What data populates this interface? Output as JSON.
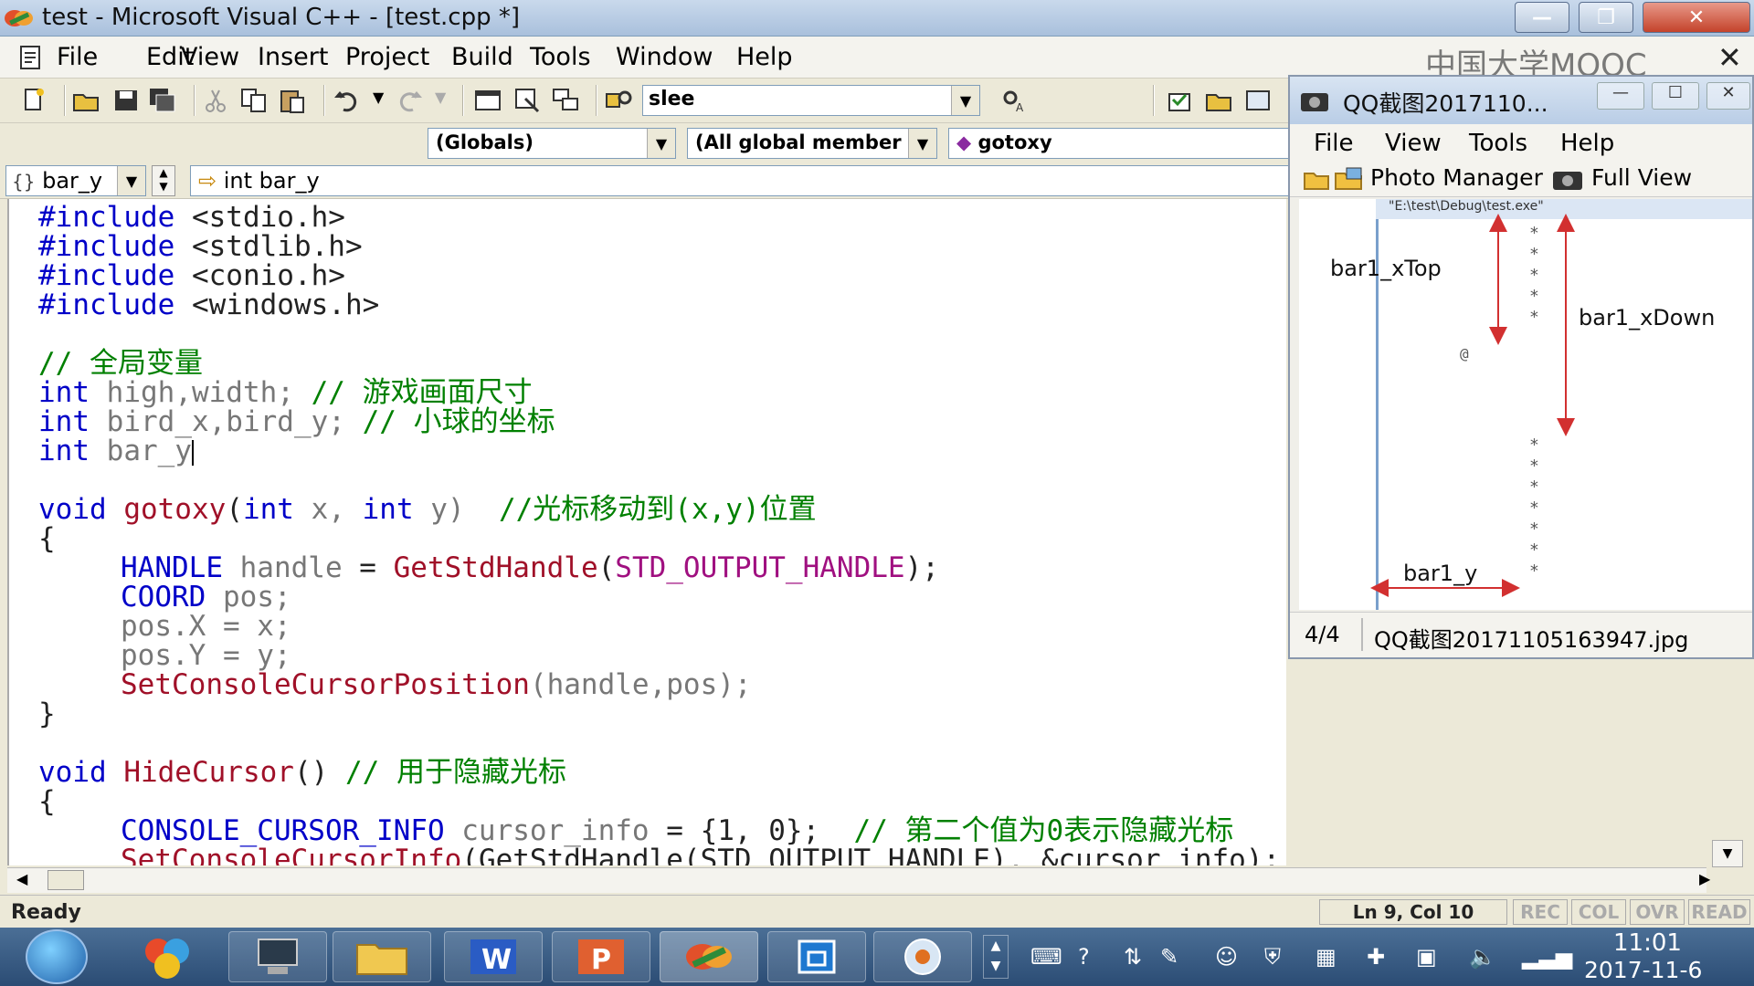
{
  "window": {
    "title": "test - Microsoft Visual C++ - [test.cpp *]",
    "min_glyph": "—",
    "max_glyph": "❐",
    "close_glyph": "✕"
  },
  "menu": [
    "File",
    "Edit",
    "View",
    "Insert",
    "Project",
    "Build",
    "Tools",
    "Window",
    "Help"
  ],
  "watermark": {
    "text": "中国大学MOOC",
    "close_glyph": "✕"
  },
  "toolbar": {
    "find_value": "slee"
  },
  "wizard": {
    "globals": "(Globals)",
    "members": "(All global member",
    "function": "gotoxy",
    "function_glyph": "◆"
  },
  "nav": {
    "symbol": "bar_y",
    "symbol_glyph": "{}",
    "definition": "int bar_y",
    "definition_glyph": "⇨"
  },
  "code": {
    "l1_kw": "#include",
    "l1_rest": " <stdio.h>",
    "l2_kw": "#include",
    "l2_rest": " <stdlib.h>",
    "l3_kw": "#include",
    "l3_rest": " <conio.h>",
    "l4_kw": "#include",
    "l4_rest": " <windows.h>",
    "l5_cm": "// 全局变量",
    "l6_kw": "int",
    "l6_id": " high,width;",
    "l6_cm": " // 游戏画面尺寸",
    "l7_kw": "int",
    "l7_id": " bird_x,bird_y;",
    "l7_cm": " // 小球的坐标",
    "l8_kw": "int",
    "l8_id": " bar_y",
    "l9_kw": "void",
    "l9_fn": " gotoxy",
    "l9_p1": "(",
    "l9_kw2": "int",
    "l9_id1": " x, ",
    "l9_kw3": "int",
    "l9_id2": " y)",
    "l9_cm": "  //光标移动到(x,y)位置",
    "l10": "{",
    "l11_ty": "HANDLE",
    "l11_id": " handle",
    "l11_tx": " = ",
    "l11_fn": "GetStdHandle",
    "l11_p": "(",
    "l11_mc": "STD_OUTPUT_HANDLE",
    "l11_end": ");",
    "l12_ty": "COORD",
    "l12_id": " pos;",
    "l13": "pos.X = x;",
    "l14": "pos.Y = y;",
    "l15_fn": "SetConsoleCursorPosition",
    "l15_id": "(handle,pos);",
    "l16": "}",
    "l17_kw": "void",
    "l17_fn": " HideCursor",
    "l17_tx": "()",
    "l17_cm": " // 用于隐藏光标",
    "l18": "{",
    "l19_ty": "CONSOLE_CURSOR_INFO",
    "l19_id": " cursor_info",
    "l19_tx": " = {1, 0};",
    "l19_cm": "  // 第二个值为0表示隐藏光标",
    "l20_fn": "SetConsoleCursorInfo",
    "l20_tx": "(GetStdHandle(STD_OUTPUT_HANDLE), &cursor_info);"
  },
  "status": {
    "ready": "Ready",
    "position": "Ln 9, Col 10",
    "flags": [
      "REC",
      "COL",
      "OVR",
      "READ"
    ]
  },
  "taskbar": {
    "time": "11:01",
    "date": "2017-11-6"
  },
  "viewer": {
    "title": "QQ截图2017110...",
    "menu": [
      "File",
      "View",
      "Tools",
      "Help"
    ],
    "photo_manager": "Photo Manager",
    "full_view": "Full View",
    "console_title": "\"E:\\test\\Debug\\test.exe\"",
    "labels": {
      "xtop": "bar1_xTop",
      "xdown": "bar1_xDown",
      "y": "bar1_y"
    },
    "bird_glyph": "@",
    "bar_glyph": "*",
    "page": "4/4",
    "filename": "QQ截图20171105163947.jpg"
  },
  "colors": {
    "keyword": "#0000c8",
    "comment": "#008000",
    "function": "#a01028",
    "macro": "#a01080",
    "annotation_arrow": "#d23030"
  }
}
